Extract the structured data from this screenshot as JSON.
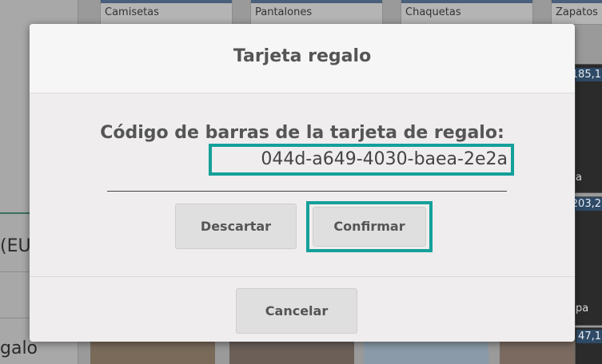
{
  "background": {
    "categories": [
      "Camisetas",
      "Pantalones",
      "Chaquetas",
      "Zapatos"
    ],
    "prices": [
      "185,1",
      "203,2",
      "47,1"
    ],
    "currency_label": "(EU",
    "language_label": "galo",
    "tile_label_1": "a",
    "tile_label_2": "pa"
  },
  "dialog": {
    "title": "Tarjeta regalo",
    "barcode_label": "Código de barras de la tarjeta de regalo:",
    "barcode_value": "044d-a649-4030-baea-2e2a",
    "discard_label": "Descartar",
    "confirm_label": "Confirmar",
    "cancel_label": "Cancelar"
  },
  "colors": {
    "highlight": "#14a09a",
    "dialog_bg": "#efeded"
  }
}
